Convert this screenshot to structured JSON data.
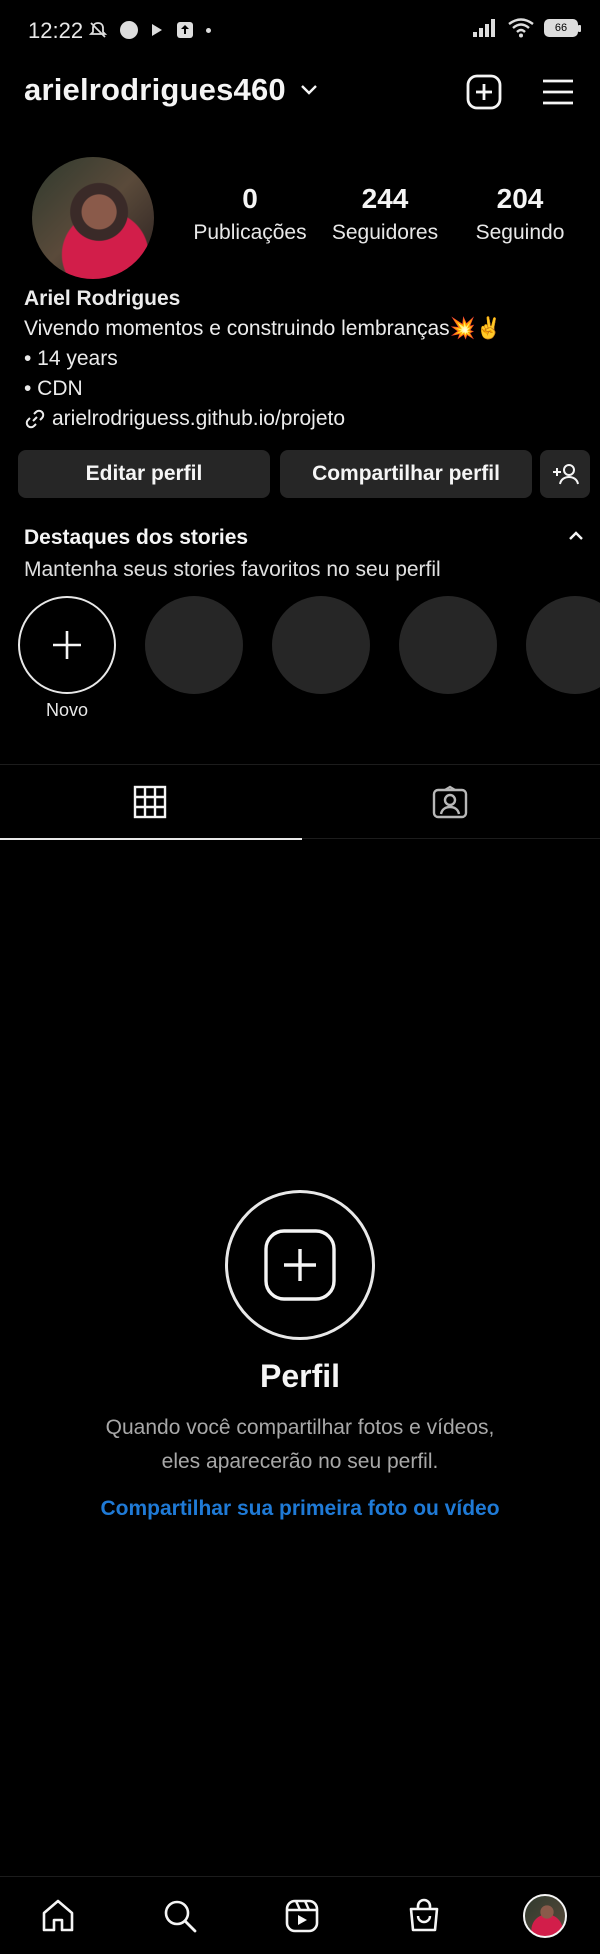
{
  "status_bar": {
    "time": "12:22",
    "battery": "66",
    "icons_left": [
      "mute-icon",
      "dot-icon",
      "play-icon",
      "upload-icon",
      "small-dot-icon"
    ],
    "icons_right": [
      "signal-icon",
      "wifi-icon",
      "battery-icon"
    ]
  },
  "header": {
    "username": "arielrodrigues460",
    "icons": [
      "chevron-down-icon",
      "new-post-icon",
      "menu-icon"
    ]
  },
  "stats": [
    {
      "value": "0",
      "label": "Publicações"
    },
    {
      "value": "244",
      "label": "Seguidores"
    },
    {
      "value": "204",
      "label": "Seguindo"
    }
  ],
  "bio": {
    "name": "Ariel Rodrigues",
    "line1": "Vivendo momentos e construindo lembranças💥✌️",
    "line2": "• 14 years",
    "line3": "• CDN",
    "link": "arielrodriguess.github.io/projeto"
  },
  "actions": {
    "edit": "Editar perfil",
    "share": "Compartilhar perfil",
    "add_person_icon": "add-person-icon"
  },
  "highlights": {
    "title": "Destaques dos stories",
    "subtitle": "Mantenha seus stories favoritos no seu perfil",
    "new_label": "Novo"
  },
  "tabs": [
    {
      "name": "grid",
      "icon": "grid-icon",
      "active": true
    },
    {
      "name": "tagged",
      "icon": "tagged-icon",
      "active": false
    }
  ],
  "empty_state": {
    "title": "Perfil",
    "description": "Quando você compartilhar fotos e vídeos, eles aparecerão no seu perfil.",
    "cta": "Compartilhar sua primeira foto ou vídeo"
  },
  "bottom_nav": [
    "home-icon",
    "search-icon",
    "reels-icon",
    "shop-icon",
    "profile-avatar"
  ],
  "colors": {
    "background": "#000000",
    "button": "#262626",
    "link": "#1f7ad6",
    "secondary_text": "#a8a8a8"
  }
}
